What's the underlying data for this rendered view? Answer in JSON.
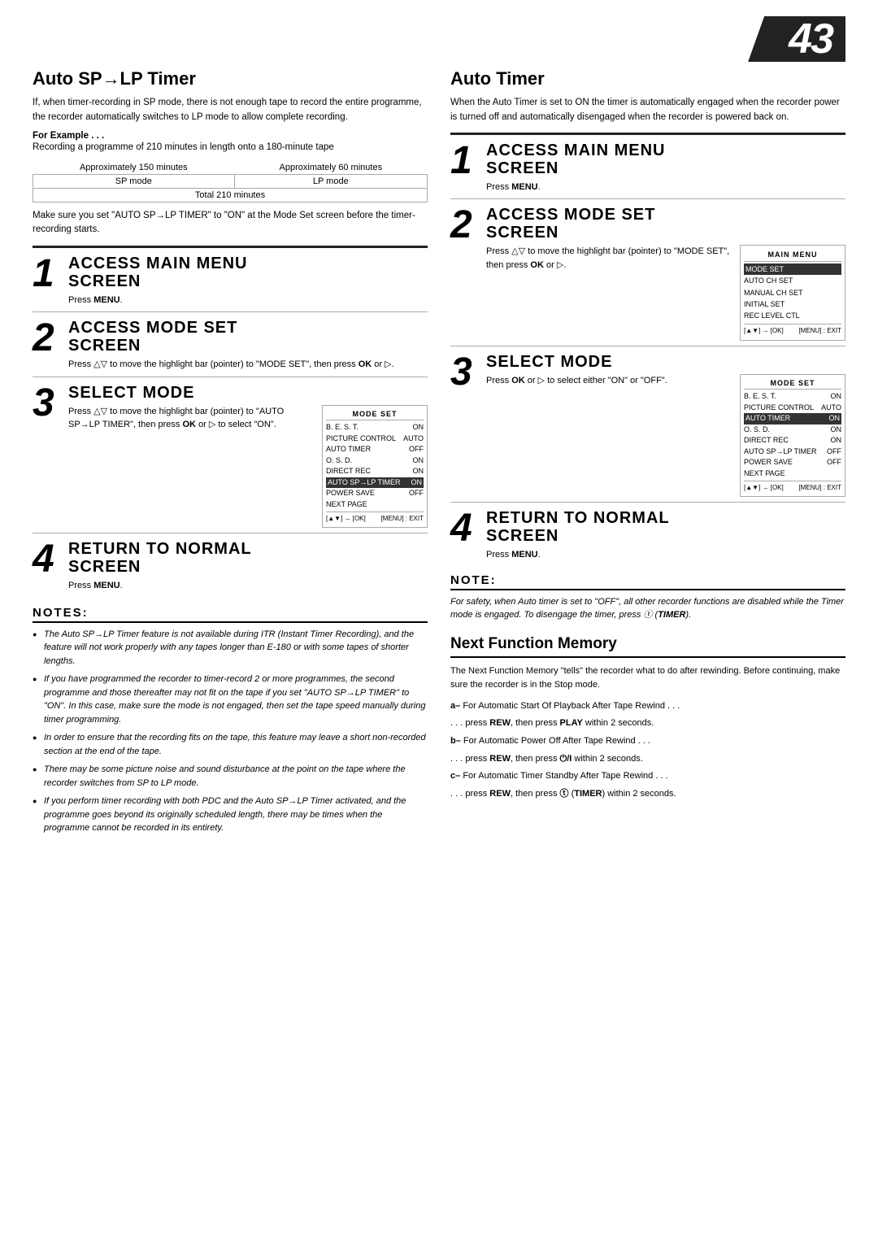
{
  "page": {
    "number": "43"
  },
  "left_col": {
    "title": "Auto SP→LP Timer",
    "intro": "If, when timer-recording in SP mode, there is not enough tape to record the entire programme, the recorder automatically switches to LP mode to allow complete recording.",
    "example_label": "For Example . . .",
    "example_desc": "Recording a programme of 210 minutes in length onto a 180-minute tape",
    "table": {
      "col1_header": "Approximately 150 minutes",
      "col2_header": "Approximately 60 minutes",
      "col1_mode": "SP mode",
      "col2_mode": "LP mode",
      "total": "Total 210 minutes"
    },
    "make_sure_text": "Make sure you set \"AUTO SP→LP TIMER\" to \"ON\" at the Mode Set screen before the timer-recording starts.",
    "steps_heading": "ACCESS MAIN MENU SCREEN",
    "step1": {
      "heading_line1": "ACCESS MAIN MENU",
      "heading_line2": "SCREEN",
      "body": "Press MENU."
    },
    "step2": {
      "heading_line1": "ACCESS MODE SET",
      "heading_line2": "SCREEN",
      "body": "Press △▽ to move the highlight bar (pointer) to \"MODE SET\", then press OK or ▷."
    },
    "step3": {
      "heading": "SELECT MODE",
      "body": "Press △▽ to move the highlight bar (pointer) to \"AUTO SP→LP TIMER\", then press OK or ▷ to select \"ON\".",
      "mode_set_box": {
        "title": "MODE SET",
        "rows": [
          {
            "label": "B. E. S. T.",
            "value": "ON"
          },
          {
            "label": "PICTURE CONTROL",
            "value": "AUTO"
          },
          {
            "label": "AUTO TIMER",
            "value": "OFF"
          },
          {
            "label": "O. S. D.",
            "value": "ON"
          },
          {
            "label": "DIRECT REC",
            "value": "ON"
          },
          {
            "label": "AUTO SP→LP TIMER",
            "value": "ON",
            "highlighted": true
          },
          {
            "label": "POWER SAVE",
            "value": "OFF"
          },
          {
            "label": "NEXT PAGE",
            "value": ""
          }
        ],
        "footer_left": "[▲▼] → [OK]",
        "footer_right": "[MENU] : EXIT"
      }
    },
    "step4": {
      "heading_line1": "RETURN TO NORMAL",
      "heading_line2": "SCREEN",
      "body": "Press MENU."
    },
    "notes_title": "NOTES:",
    "notes": [
      "The Auto SP→LP Timer feature is not available during ITR (Instant Timer Recording), and the feature will not work properly with any tapes longer than E-180 or with some tapes of shorter lengths.",
      "If you have programmed the recorder to timer-record 2 or more programmes, the second programme and those thereafter may not fit on the tape if you set \"AUTO SP→LP TIMER\" to \"ON\". In this case, make sure the mode is not engaged, then set the tape speed manually during timer programming.",
      "In order to ensure that the recording fits on the tape, this feature may leave a short non-recorded section at the end of the tape.",
      "There may be some picture noise and sound disturbance at the point on the tape where the recorder switches from SP to LP mode.",
      "If you perform timer recording with both PDC and the Auto SP→LP Timer activated, and the programme goes beyond its originally scheduled length, there may be times when the programme cannot be recorded in its entirety."
    ]
  },
  "right_col": {
    "title": "Auto Timer",
    "intro": "When the Auto Timer is set to ON the timer is automatically engaged when the recorder power is turned off and automatically disengaged when the recorder is powered back on.",
    "step1": {
      "heading_line1": "ACCESS MAIN MENU",
      "heading_line2": "SCREEN",
      "body": "Press MENU."
    },
    "step2": {
      "heading_line1": "ACCESS MODE SET",
      "heading_line2": "SCREEN",
      "body": "Press △▽ to move the highlight bar (pointer) to \"MODE SET\", then press OK or ▷.",
      "main_menu_box": {
        "title": "MAIN MENU",
        "rows": [
          {
            "label": "MODE SET",
            "highlighted": true
          },
          {
            "label": "AUTO CH SET"
          },
          {
            "label": "MANUAL CH SET"
          },
          {
            "label": "INITIAL SET"
          },
          {
            "label": "REC LEVEL CTL"
          }
        ],
        "footer_left": "[▲▼] → [OK]",
        "footer_right": "[MENU] : EXIT"
      }
    },
    "step3": {
      "heading": "SELECT MODE",
      "body": "Press OK or ▷ to select either \"ON\" or \"OFF\".",
      "mode_set_box": {
        "title": "MODE SET",
        "rows": [
          {
            "label": "B. E. S. T.",
            "value": "ON"
          },
          {
            "label": "PICTURE CONTROL",
            "value": "AUTO"
          },
          {
            "label": "AUTO TIMER",
            "value": "ON",
            "highlighted": true
          },
          {
            "label": "O. S. D.",
            "value": "ON"
          },
          {
            "label": "DIRECT REC",
            "value": "ON"
          },
          {
            "label": "AUTO SP→LP TIMER",
            "value": "OFF"
          },
          {
            "label": "POWER SAVE",
            "value": "OFF"
          },
          {
            "label": "NEXT PAGE",
            "value": ""
          }
        ],
        "footer_left": "[▲▼] → [OK]",
        "footer_right": "[MENU] : EXIT"
      }
    },
    "step4": {
      "heading_line1": "RETURN TO NORMAL",
      "heading_line2": "SCREEN",
      "body": "Press MENU."
    },
    "note_title": "NOTE:",
    "note_body": "For safety, when Auto timer is set to \"OFF\", all other recorder functions are disabled while the Timer mode is engaged. To disengage the timer, press ⓣ (TIMER).",
    "next_function": {
      "title": "Next Function Memory",
      "intro": "The Next Function Memory \"tells\" the recorder what to do after rewinding. Before continuing, make sure the recorder is in the Stop mode.",
      "point_a_label": "a–",
      "point_a_text": "For Automatic Start Of Playback After Tape Rewind . . .",
      "point_a_detail": ". . . press REW, then press PLAY within 2 seconds.",
      "point_b_label": "b–",
      "point_b_text": "For Automatic Power Off After Tape Rewind . . .",
      "point_b_detail": ". . . press REW, then press ⏻/I within 2 seconds.",
      "point_c_label": "c–",
      "point_c_text": "For Automatic Timer Standby After Tape Rewind . . .",
      "point_c_detail": ". . . press REW, then press ⓣ (TIMER) within 2 seconds."
    }
  }
}
